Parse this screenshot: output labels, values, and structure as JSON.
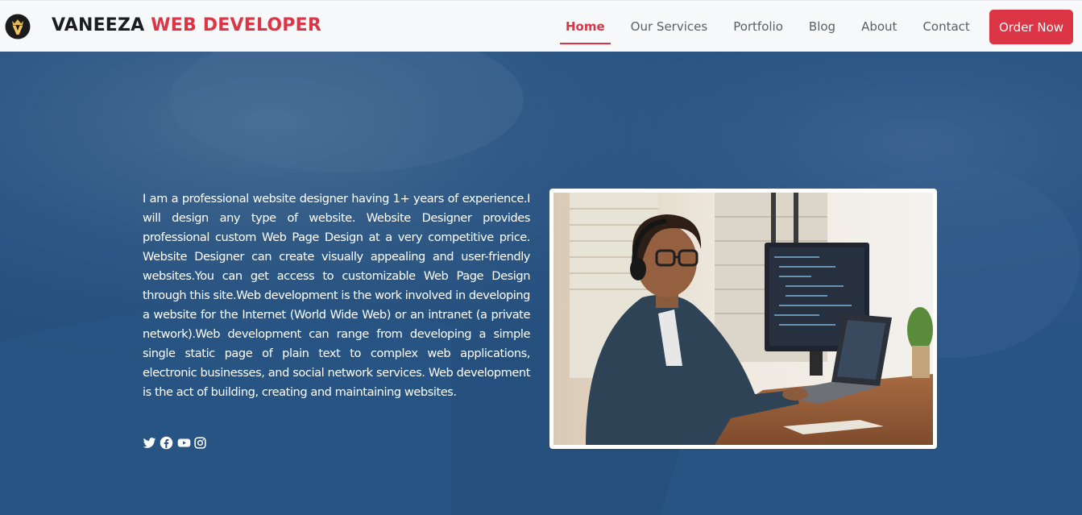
{
  "brand": {
    "part1": "VANEEZA",
    "part2": "WEB DEVELOPER",
    "logo_icon": "crown-v-logo-icon"
  },
  "nav": {
    "items": [
      {
        "label": "Home",
        "active": true
      },
      {
        "label": "Our Services",
        "active": false
      },
      {
        "label": "Portfolio",
        "active": false
      },
      {
        "label": "Blog",
        "active": false
      },
      {
        "label": "About",
        "active": false
      },
      {
        "label": "Contact",
        "active": false
      }
    ],
    "cta_label": "Order Now"
  },
  "hero": {
    "description": "I am a professional website designer having 1+ years of experience.I will design any type of website. Website Designer provides professional custom Web Page Design at a very competitive price. Website Designer can create visually appealing and user-friendly websites.You can get access to customizable Web Page Design through this site.Web development is the work involved in developing a website for the Internet (World Wide Web) or an intranet (a private network).Web development can range from developing a simple single static page of plain text to complex web applications, electronic businesses, and social network services. Web development is the act of building, creating and maintaining websites.",
    "socials": [
      "twitter-icon",
      "facebook-icon",
      "youtube-icon",
      "instagram-icon"
    ],
    "image_alt": "developer-at-desk-photo"
  },
  "colors": {
    "accent": "#dc3545",
    "hero_overlay": "#24507f",
    "nav_bg": "#f8f9fb",
    "text_dark": "#1d1d1f"
  }
}
